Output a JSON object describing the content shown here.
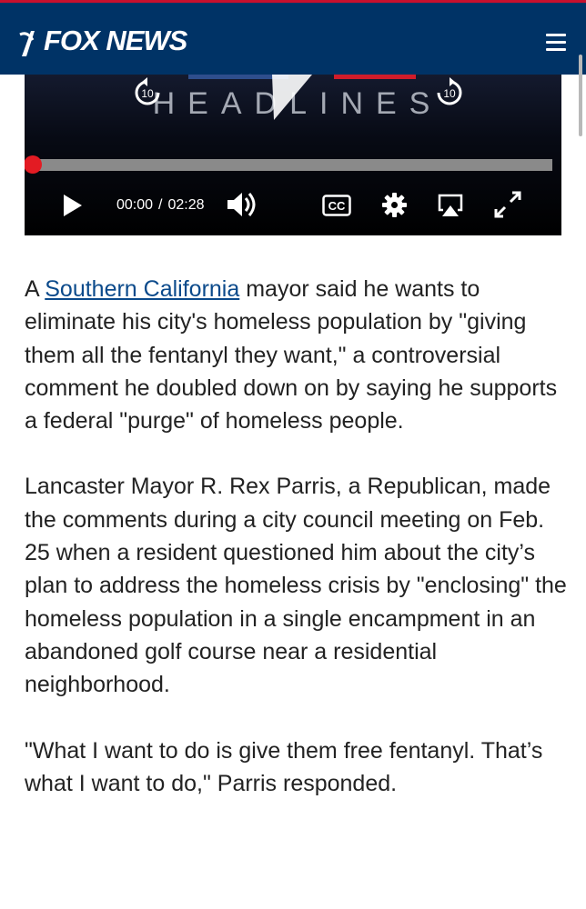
{
  "header": {
    "logo_text": "FOX NEWS",
    "accent_color": "#c8102e",
    "background_color": "#003366",
    "menu_icon": "hamburger-icon"
  },
  "video": {
    "headline_text": "HEADLINES",
    "skip_back_seconds": "10",
    "skip_forward_seconds": "10",
    "current_time": "00:00",
    "time_separator": "/",
    "duration": "02:28",
    "progress_fraction": 0,
    "cc_label": "CC",
    "progress_handle_color": "#e31b23",
    "icons": [
      "play-icon",
      "volume-icon",
      "closed-captions-icon",
      "settings-gear-icon",
      "airplay-icon",
      "fullscreen-icon"
    ]
  },
  "article": {
    "p1_prefix": "A ",
    "p1_link": "Southern California",
    "p1_rest": " mayor said he wants to eliminate his city's homeless population by \"giving them all the fentanyl they want,\" a controversial comment he doubled down on by saying he supports a federal \"purge\" of homeless people.",
    "p2": "Lancaster Mayor R. Rex Parris, a Republican, made the comments during a city council meeting on Feb. 25 when a resident questioned him about the city’s plan to address the homeless crisis by \"enclosing\" the homeless population in a single encampment in an abandoned golf course near a residential neighborhood.",
    "p3": "\"What I want to do is give them free fentanyl. That’s what I want to do,\" Parris responded.",
    "link_color": "#0b4a8b"
  }
}
